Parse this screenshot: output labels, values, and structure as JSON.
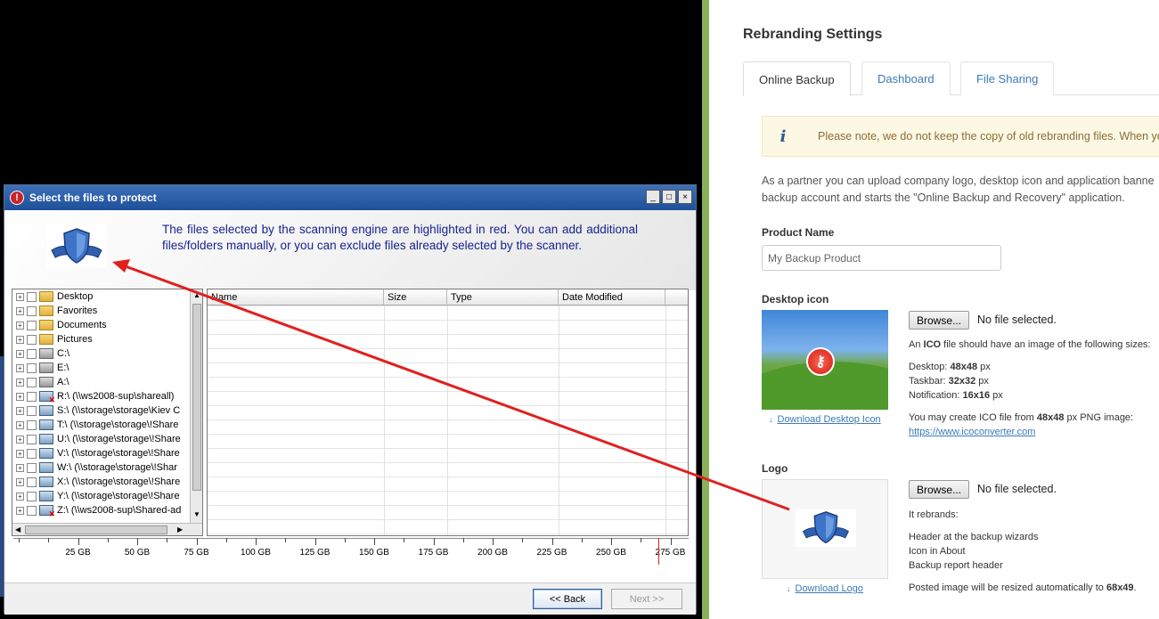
{
  "dialog": {
    "title": "Select the files to protect",
    "intro": "The files selected by the scanning engine are highlighted in red.  You can add additional files/folders manually, or you can exclude files already selected by the scanner.",
    "window_buttons": [
      "_",
      "□",
      "×"
    ],
    "tree": [
      {
        "label": "Desktop",
        "icon": "folder-icon"
      },
      {
        "label": "Favorites",
        "icon": "folder-icon"
      },
      {
        "label": "Documents",
        "icon": "folder-icon"
      },
      {
        "label": "Pictures",
        "icon": "folder-icon"
      },
      {
        "label": "C:\\",
        "icon": "drive-icon"
      },
      {
        "label": "E:\\",
        "icon": "drive-icon"
      },
      {
        "label": "A:\\",
        "icon": "floppy-icon"
      },
      {
        "label": "R:\\ (\\\\ws2008-sup\\shareall)",
        "icon": "disconnected-network-drive-icon"
      },
      {
        "label": "S:\\ (\\\\storage\\storage\\Kiev C",
        "icon": "network-drive-icon"
      },
      {
        "label": "T:\\ (\\\\storage\\storage\\!Share",
        "icon": "network-drive-icon"
      },
      {
        "label": "U:\\ (\\\\storage\\storage\\!Share",
        "icon": "network-drive-icon"
      },
      {
        "label": "V:\\ (\\\\storage\\storage\\!Share",
        "icon": "network-drive-icon"
      },
      {
        "label": "W:\\ (\\\\storage\\storage\\!Shar",
        "icon": "network-drive-icon"
      },
      {
        "label": "X:\\ (\\\\storage\\storage\\!Share",
        "icon": "network-drive-icon"
      },
      {
        "label": "Y:\\ (\\\\storage\\storage\\!Share",
        "icon": "network-drive-icon"
      },
      {
        "label": "Z:\\ (\\\\ws2008-sup\\Shared-ad",
        "icon": "disconnected-network-drive-icon"
      }
    ],
    "columns": [
      "Name",
      "Size",
      "Type",
      "Date Modified"
    ],
    "ruler": [
      "25 GB",
      "50 GB",
      "75 GB",
      "100 GB",
      "125 GB",
      "150 GB",
      "175 GB",
      "200 GB",
      "225 GB",
      "250 GB",
      "275 GB"
    ],
    "back_label": "<< Back",
    "next_label": "Next >>"
  },
  "settings": {
    "title": "Rebranding Settings",
    "tabs": [
      "Online Backup",
      "Dashboard",
      "File Sharing"
    ],
    "active_tab": "Online Backup",
    "alert_icon": "i",
    "alert": "Please note, we do not keep the copy of old rebranding files. When yo",
    "description_line1": "As a partner you can upload company logo, desktop icon and application banne",
    "description_line2": "backup account and starts the \"Online Backup and Recovery\" application.",
    "product_name_label": "Product Name",
    "product_name_placeholder": "My Backup Product",
    "desktop_icon_label": "Desktop icon",
    "browse_label": "Browse...",
    "no_file": "No file selected.",
    "ico_info_prefix": "An ",
    "ico_info_bold": "ICO",
    "ico_info_suffix": " file should have an image of the following sizes:",
    "size_desktop_label": "Desktop: ",
    "size_desktop": "48x48",
    "size_taskbar_label": "Taskbar: ",
    "size_taskbar": "32x32",
    "size_notification_label": "Notification: ",
    "size_notification": "16x16",
    "px": " px",
    "create_ico_prefix": "You may create ICO file from ",
    "create_ico_bold": "48x48",
    "create_ico_suffix": " px PNG image:",
    "ico_converter_link": "https://www.icoconverter.com",
    "download_desktop_icon": "Download Desktop Icon",
    "logo_label": "Logo",
    "it_rebrands": "It rebrands:",
    "rebrand_items": [
      "Header at the backup wizards",
      "Icon in About",
      "Backup report header"
    ],
    "posted_prefix": "Posted image will be resized automatically to ",
    "posted_bold": "68x49",
    "posted_suffix": ".",
    "download_logo": "Download Logo"
  },
  "colors": {
    "annotation_arrow": "#e02020",
    "link": "#3c7ab8",
    "dialog_text": "#16238f",
    "divider": "#88b15a"
  }
}
